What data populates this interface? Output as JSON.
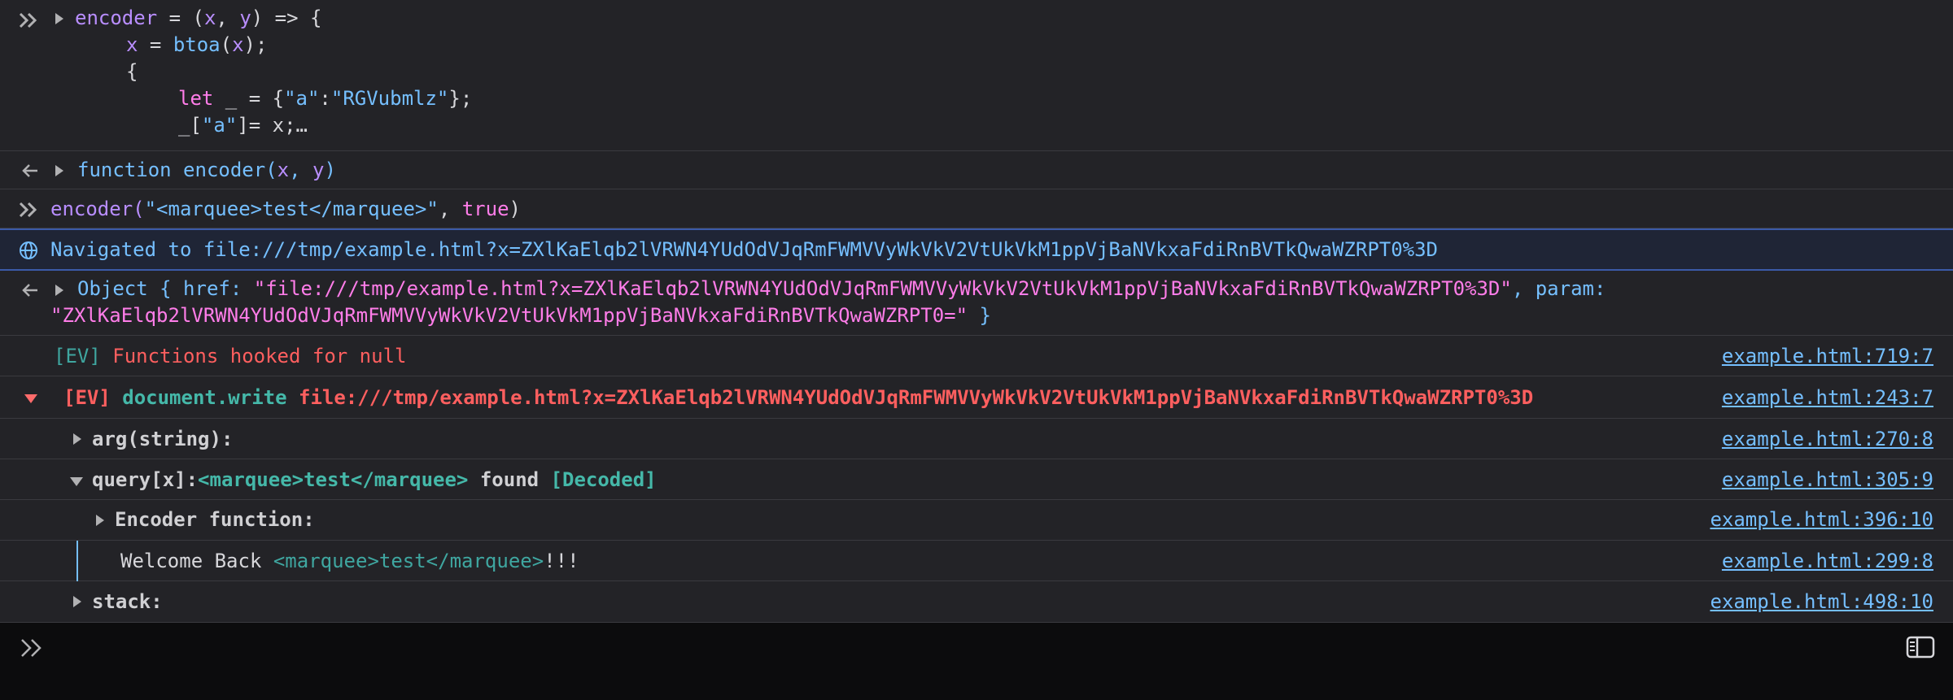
{
  "rows": {
    "input1": {
      "lines": [
        [
          "encoder",
          " = (",
          "x",
          ", ",
          "y",
          ") => {"
        ],
        [
          "x",
          " = ",
          "btoa",
          "(",
          "x",
          ");"
        ],
        [
          "{"
        ],
        [
          "let",
          " _ = {",
          "\"a\"",
          ":",
          "\"RGVubmlz\"",
          "};"
        ],
        [
          "_[",
          "\"a\"",
          "]= x;…"
        ]
      ]
    },
    "output1": {
      "text_kw": "function",
      "text_name": " encoder(",
      "x": "x",
      "comma": ", ",
      "y": "y",
      "close": ")"
    },
    "input2": {
      "fn": "encoder(",
      "str": "\"<marquee>test</marquee>\"",
      "comma": ", ",
      "bool": "true",
      "close": ")"
    },
    "nav": {
      "text": "Navigated to file:///tmp/example.html?x=ZXlKaElqb2lVRWN4YUdOdVJqRmFWMVVyWkVkV2VtUkVkM1ppVjBaNVkxaFdiRnBVTkQwaWZRPT0%3D"
    },
    "object": {
      "prefix": "Object { ",
      "href_key": "href: ",
      "href_val": "\"file:///tmp/example.html?x=ZXlKaElqb2lVRWN4YUdOdVJqRmFWMVVyWkVkV2VtUkVkM1ppVjBaNVkxaFdiRnBVTkQwaWZRPT0%3D\"",
      "param_key": ", param:",
      "param_val": "\"ZXlKaElqb2lVRWN4YUdOdVJqRmFWMVVyWkVkV2VtUkVkM1ppVjBaNVkxaFdiRnBVTkQwaWZRPT0=\"",
      "suffix": " }"
    },
    "hooked": {
      "tag": "[EV]",
      "msg": "Functions hooked for null",
      "src": "example.html:719:7"
    },
    "docwrite": {
      "tag": "[EV]",
      "fn": "document.write",
      "url": "file:///tmp/example.html?x=ZXlKaElqb2lVRWN4YUdOdVJqRmFWMVVyWkVkV2VtUkVkM1ppVjBaNVkxaFdiRnBVTkQwaWZRPT0%3D",
      "src": "example.html:243:7"
    },
    "arg": {
      "label": "arg(string):",
      "src": "example.html:270:8"
    },
    "query": {
      "key": "query[x]:",
      "val": "<marquee>test</marquee>",
      "found": " found ",
      "decoded": "[Decoded]",
      "src": "example.html:305:9"
    },
    "encoder_fn": {
      "label": "Encoder function:",
      "src": "example.html:396:10"
    },
    "welcome": {
      "pre": "Welcome Back ",
      "val": "<marquee>test</marquee>",
      "post": "!!!",
      "src": "example.html:299:8"
    },
    "stack": {
      "label": "stack:",
      "src": "example.html:498:10"
    }
  },
  "icons": {
    "prompt": "double-chevron-icon",
    "result": "back-arrow-icon",
    "nav": "globe-icon",
    "sidebar_toggle": "sidebar-toggle-icon"
  },
  "colors": {
    "background": "#232327",
    "input_bg": "#0c0c0d",
    "nav_border": "#3b5aa8",
    "link": "#75bfff",
    "error": "#ff5f5f",
    "teal": "#45b8a9"
  }
}
